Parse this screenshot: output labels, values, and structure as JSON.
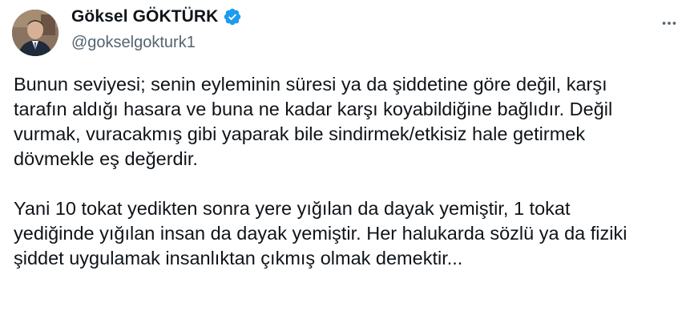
{
  "author": {
    "display_name": "Göksel GÖKTÜRK",
    "handle": "@gokselgokturk1",
    "verified": true,
    "verified_color": "#1d9bf0"
  },
  "menu": {
    "icon": "more-horizontal-icon"
  },
  "tweet": {
    "paragraph_1": "Bunun seviyesi; senin eyleminin süresi ya da şiddetine göre değil, karşı\ntarafın aldığı hasara ve buna ne kadar karşı koyabildiğine bağlıdır. Değil\nvurmak, vuracakmış gibi yaparak bile sindirmek/etkisiz hale getirmek\ndövmekle eş değerdir.",
    "paragraph_2": "Yani 10 tokat yedikten sonra yere yığılan da dayak yemiştir, 1 tokat\nyediğinde yığılan insan da dayak yemiştir. Her halukarda sözlü ya da fiziki\nşiddet uygulamak insanlıktan çıkmış olmak demektir..."
  },
  "colors": {
    "text_primary": "#0f1419",
    "text_secondary": "#536471",
    "background": "#ffffff"
  }
}
